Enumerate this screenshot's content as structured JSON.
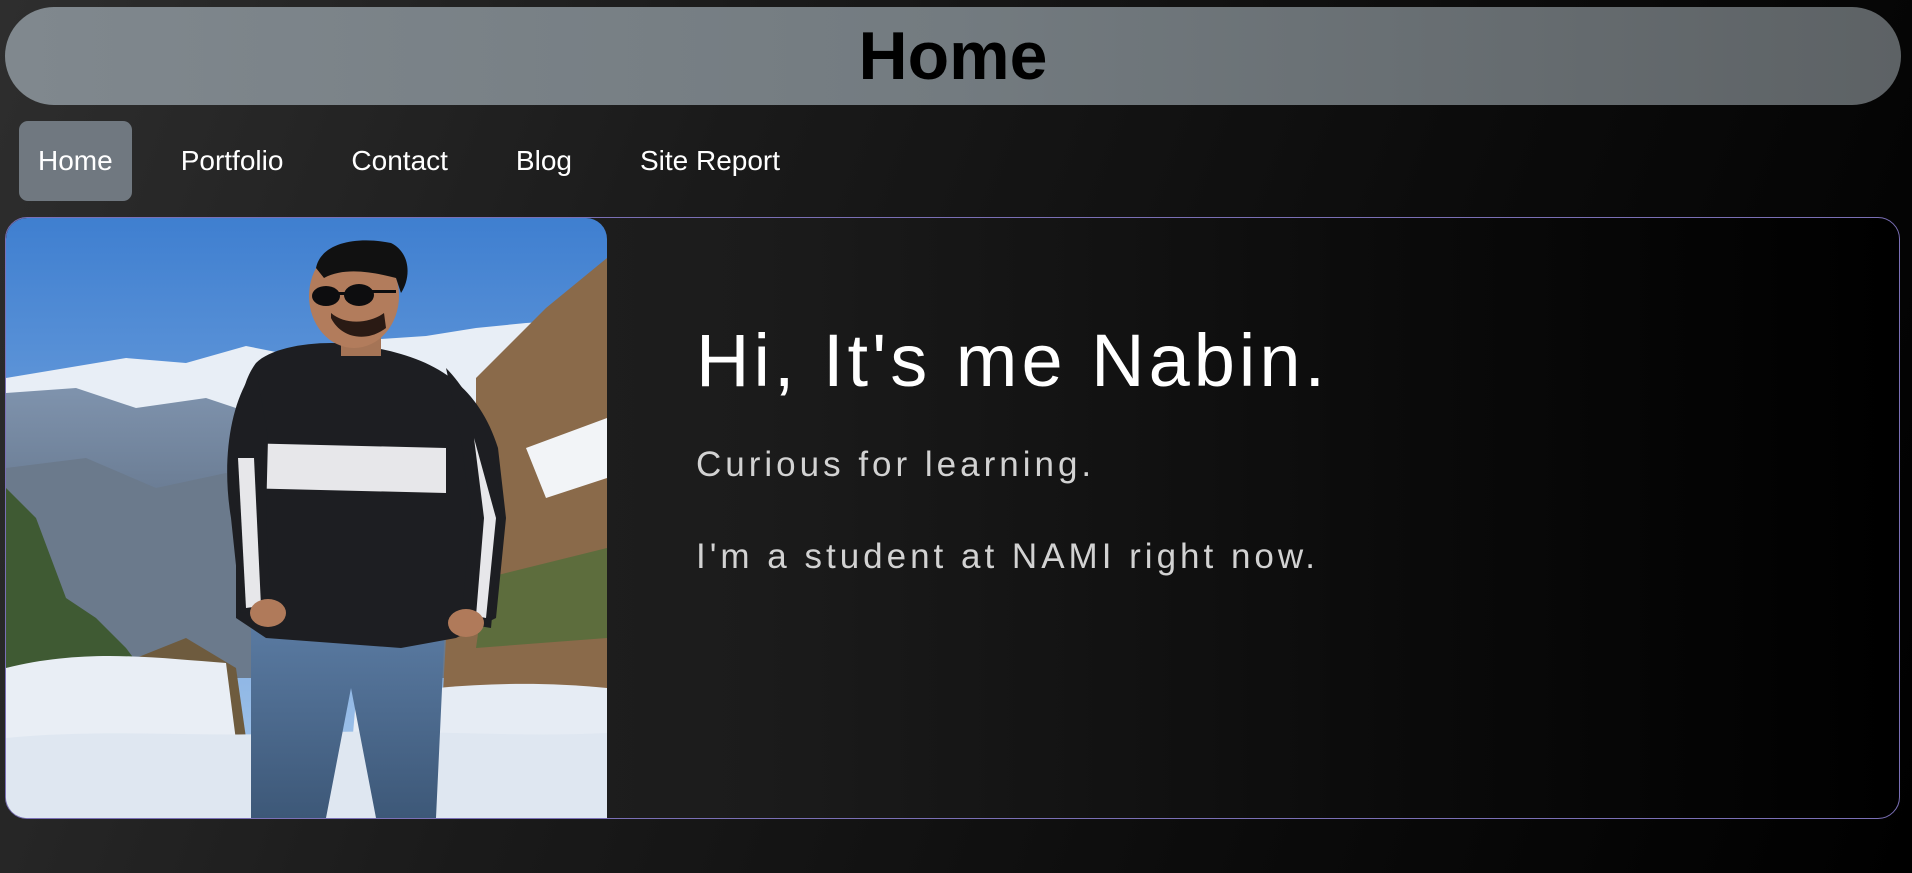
{
  "header": {
    "title": "Home"
  },
  "nav": {
    "items": [
      {
        "label": "Home",
        "active": true
      },
      {
        "label": "Portfolio",
        "active": false
      },
      {
        "label": "Contact",
        "active": false
      },
      {
        "label": "Blog",
        "active": false
      },
      {
        "label": "Site Report",
        "active": false
      }
    ]
  },
  "profile": {
    "photo_icon": "profile-photo",
    "heading": "Hi, It's me Nabin.",
    "tagline": "Curious for learning.",
    "status": "I'm a student at NAMI right now."
  },
  "colors": {
    "header_bg": "#737b80",
    "nav_active_bg": "#707880",
    "card_border": "#7a6fb5",
    "text_primary": "#ffffff",
    "text_secondary": "#d2d2d2"
  }
}
